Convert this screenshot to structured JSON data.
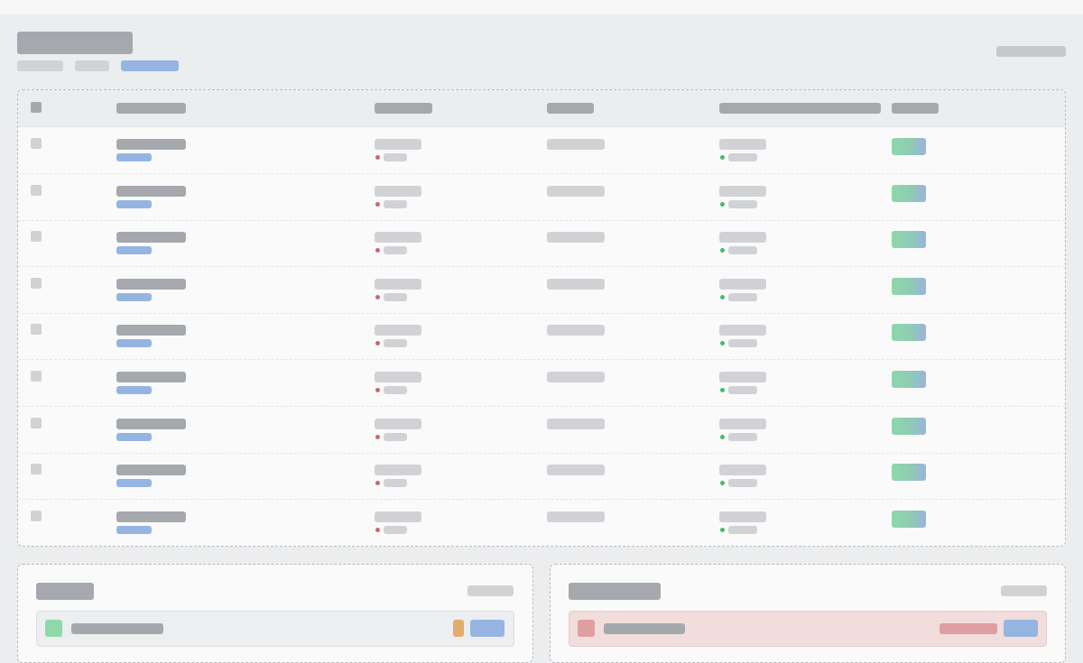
{
  "page": {
    "title": "",
    "breadcrumb": [
      "",
      "",
      ""
    ],
    "action_label": ""
  },
  "table": {
    "headers": [
      "",
      "",
      "",
      "",
      ""
    ],
    "rows": [
      {
        "name": "",
        "sub": "",
        "col2": "",
        "col2_status": "",
        "col3": "",
        "col4": "",
        "col4_status": "",
        "badge": ""
      },
      {
        "name": "",
        "sub": "",
        "col2": "",
        "col2_status": "",
        "col3": "",
        "col4": "",
        "col4_status": "",
        "badge": ""
      },
      {
        "name": "",
        "sub": "",
        "col2": "",
        "col2_status": "",
        "col3": "",
        "col4": "",
        "col4_status": "",
        "badge": ""
      },
      {
        "name": "",
        "sub": "",
        "col2": "",
        "col2_status": "",
        "col3": "",
        "col4": "",
        "col4_status": "",
        "badge": ""
      },
      {
        "name": "",
        "sub": "",
        "col2": "",
        "col2_status": "",
        "col3": "",
        "col4": "",
        "col4_status": "",
        "badge": ""
      },
      {
        "name": "",
        "sub": "",
        "col2": "",
        "col2_status": "",
        "col3": "",
        "col4": "",
        "col4_status": "",
        "badge": ""
      },
      {
        "name": "",
        "sub": "",
        "col2": "",
        "col2_status": "",
        "col3": "",
        "col4": "",
        "col4_status": "",
        "badge": ""
      },
      {
        "name": "",
        "sub": "",
        "col2": "",
        "col2_status": "",
        "col3": "",
        "col4": "",
        "col4_status": "",
        "badge": ""
      },
      {
        "name": "",
        "sub": "",
        "col2": "",
        "col2_status": "",
        "col3": "",
        "col4": "",
        "col4_status": "",
        "badge": ""
      }
    ]
  },
  "cards": [
    {
      "title": "",
      "link": "",
      "item_label": "",
      "item_color": "#8fd9a8",
      "tag_color": "#e3ac6b",
      "button_color": "#96b4e1",
      "row_bg": "#eceeef"
    },
    {
      "title": "",
      "link": "",
      "item_label": "",
      "item_color": "#df9ea0",
      "tag_color": "#df9ea0",
      "button_color": "#96b4e1",
      "row_bg": "#f2dddd"
    }
  ],
  "colors": {
    "status_left": "#c46a6a",
    "status_right": "#3fbf6a",
    "accent": "#96b4e1"
  }
}
